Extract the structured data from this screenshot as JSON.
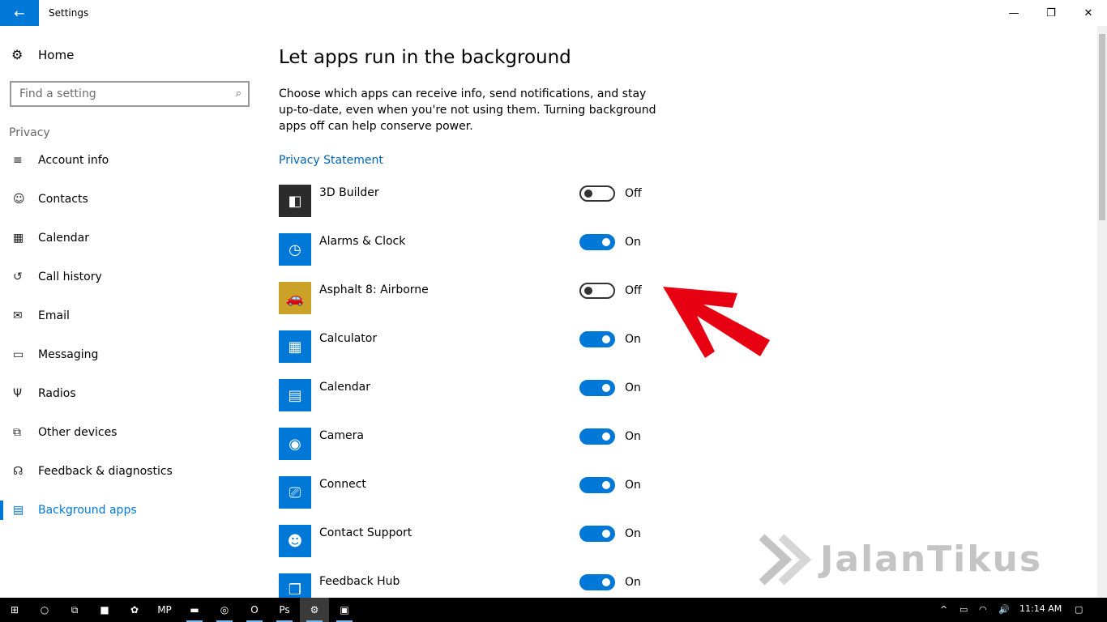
{
  "window": {
    "title": "Settings",
    "controls": [
      {
        "name": "minimize-button",
        "glyph": "—"
      },
      {
        "name": "restore-button",
        "glyph": "❐"
      },
      {
        "name": "close-button",
        "glyph": "✕"
      }
    ]
  },
  "sidebar": {
    "home_label": "Home",
    "search_placeholder": "Find a setting",
    "section": "Privacy",
    "items": [
      {
        "label": "Account info",
        "icon": "account-info-icon",
        "glyph": "≡",
        "active": false
      },
      {
        "label": "Contacts",
        "icon": "contacts-icon",
        "glyph": "☺",
        "active": false
      },
      {
        "label": "Calendar",
        "icon": "calendar-icon",
        "glyph": "▦",
        "active": false
      },
      {
        "label": "Call history",
        "icon": "call-history-icon",
        "glyph": "↺",
        "active": false
      },
      {
        "label": "Email",
        "icon": "email-icon",
        "glyph": "✉",
        "active": false
      },
      {
        "label": "Messaging",
        "icon": "messaging-icon",
        "glyph": "▭",
        "active": false
      },
      {
        "label": "Radios",
        "icon": "radios-icon",
        "glyph": "Ψ",
        "active": false
      },
      {
        "label": "Other devices",
        "icon": "other-devices-icon",
        "glyph": "⧉",
        "active": false
      },
      {
        "label": "Feedback & diagnostics",
        "icon": "feedback-icon",
        "glyph": "☊",
        "active": false
      },
      {
        "label": "Background apps",
        "icon": "background-apps-icon",
        "glyph": "▤",
        "active": true
      }
    ]
  },
  "main": {
    "title": "Let apps run in the background",
    "description": "Choose which apps can receive info, send notifications, and stay up-to-date, even when you're not using them. Turning background apps off can help conserve power.",
    "privacy_link": "Privacy Statement",
    "apps": [
      {
        "name": "3D Builder",
        "state": "Off",
        "on": false,
        "icon": "3d-builder-icon",
        "icon_bg": "#2b2b2b",
        "glyph": "◧"
      },
      {
        "name": "Alarms & Clock",
        "state": "On",
        "on": true,
        "icon": "alarms-clock-icon",
        "icon_bg": "#0078d7",
        "glyph": "◷"
      },
      {
        "name": "Asphalt 8: Airborne",
        "state": "Off",
        "on": false,
        "icon": "asphalt-icon",
        "icon_bg": "#c9a227",
        "glyph": "🚗"
      },
      {
        "name": "Calculator",
        "state": "On",
        "on": true,
        "icon": "calculator-icon",
        "icon_bg": "#0078d7",
        "glyph": "▦"
      },
      {
        "name": "Calendar",
        "state": "On",
        "on": true,
        "icon": "calendar-app-icon",
        "icon_bg": "#0078d7",
        "glyph": "▤"
      },
      {
        "name": "Camera",
        "state": "On",
        "on": true,
        "icon": "camera-icon",
        "icon_bg": "#0078d7",
        "glyph": "◉"
      },
      {
        "name": "Connect",
        "state": "On",
        "on": true,
        "icon": "connect-icon",
        "icon_bg": "#0078d7",
        "glyph": "⎚"
      },
      {
        "name": "Contact Support",
        "state": "On",
        "on": true,
        "icon": "contact-support-icon",
        "icon_bg": "#0078d7",
        "glyph": "☻"
      },
      {
        "name": "Feedback Hub",
        "state": "On",
        "on": true,
        "icon": "feedback-hub-icon",
        "icon_bg": "#0078d7",
        "glyph": "❐"
      }
    ]
  },
  "watermark": "JalanTikus",
  "taskbar": {
    "items": [
      {
        "name": "start-button",
        "glyph": "⊞",
        "pinned": false,
        "active": false
      },
      {
        "name": "cortana-button",
        "glyph": "○",
        "pinned": false,
        "active": false
      },
      {
        "name": "task-view-button",
        "glyph": "⧉",
        "pinned": false,
        "active": false
      },
      {
        "name": "sticky-notes-icon",
        "glyph": "■",
        "pinned": false,
        "active": false
      },
      {
        "name": "app-icon-paint",
        "glyph": "✿",
        "pinned": false,
        "active": false
      },
      {
        "name": "app-icon-mp",
        "glyph": "MP",
        "pinned": false,
        "active": false
      },
      {
        "name": "file-explorer-icon",
        "glyph": "▬",
        "pinned": true,
        "active": false
      },
      {
        "name": "chrome-icon",
        "glyph": "◎",
        "pinned": true,
        "active": false
      },
      {
        "name": "outlook-icon",
        "glyph": "O",
        "pinned": true,
        "active": false
      },
      {
        "name": "photoshop-icon",
        "glyph": "Ps",
        "pinned": true,
        "active": false
      },
      {
        "name": "settings-taskbar-icon",
        "glyph": "⚙",
        "pinned": true,
        "active": true
      },
      {
        "name": "remote-desktop-icon",
        "glyph": "▣",
        "pinned": true,
        "active": false
      }
    ],
    "tray": [
      {
        "name": "tray-chevron-icon",
        "glyph": "^"
      },
      {
        "name": "battery-icon",
        "glyph": "▭"
      },
      {
        "name": "wifi-icon",
        "glyph": "◠"
      },
      {
        "name": "volume-icon",
        "glyph": "🔊"
      }
    ],
    "time": "11:14 AM",
    "notification_glyph": "▢"
  },
  "colors": {
    "accent": "#0078d7",
    "link": "#0063b1",
    "arrow": "#e60012"
  }
}
